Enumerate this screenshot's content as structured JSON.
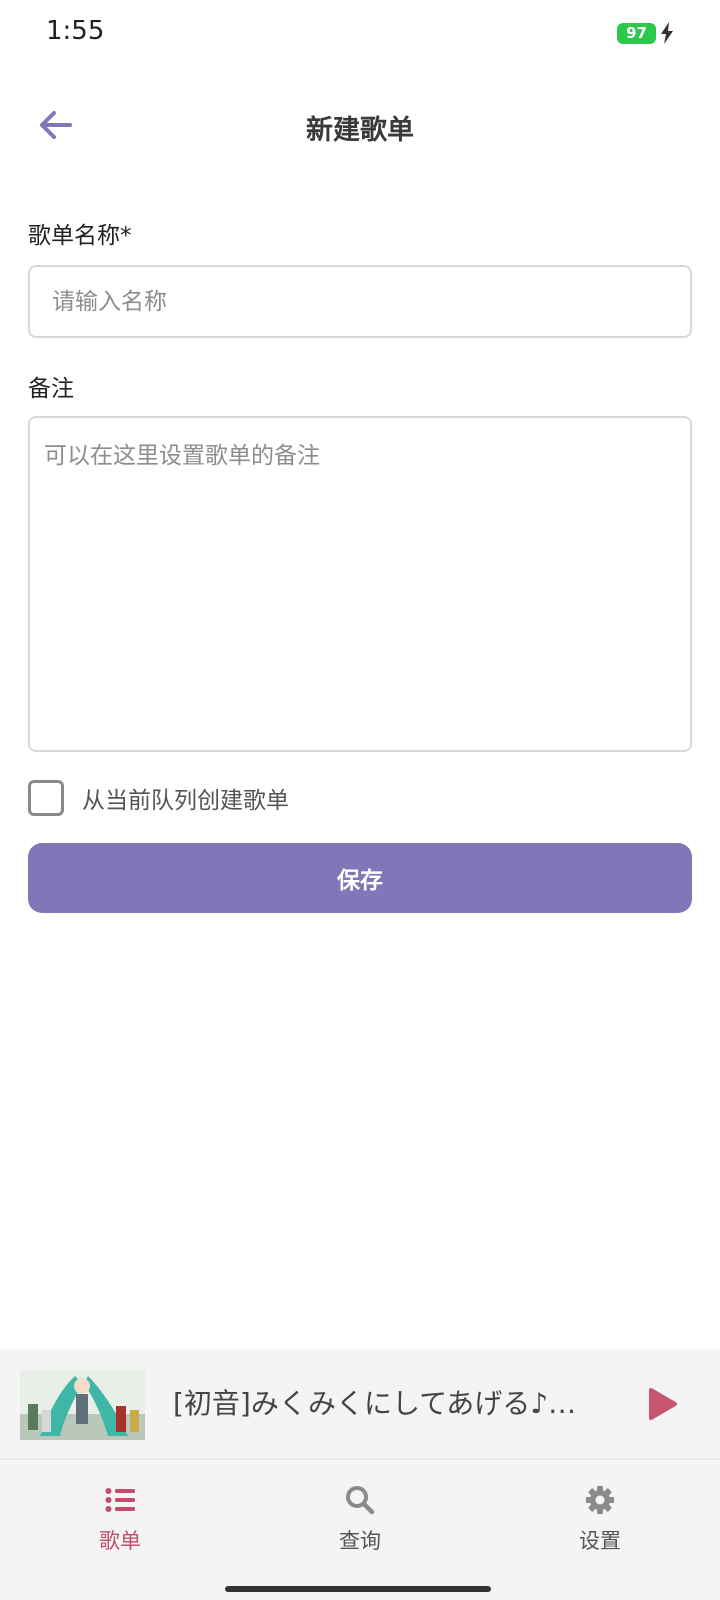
{
  "status_bar": {
    "time": "1:55",
    "battery": "97"
  },
  "header": {
    "title": "新建歌单"
  },
  "form": {
    "name_label": "歌单名称*",
    "name_placeholder": "请输入名称",
    "name_value": "",
    "note_label": "备注",
    "note_placeholder": "可以在这里设置歌单的备注",
    "note_value": "",
    "queue_checkbox_label": "从当前队列创建歌单",
    "queue_checkbox_checked": false,
    "save_label": "保存"
  },
  "mini_player": {
    "song_title": "[初音]みくみくにしてあげる♪【してやんよ】"
  },
  "nav": {
    "items": [
      {
        "label": "歌单",
        "icon": "list-icon",
        "active": true
      },
      {
        "label": "查询",
        "icon": "search-icon",
        "active": false
      },
      {
        "label": "设置",
        "icon": "gear-icon",
        "active": false
      }
    ]
  },
  "colors": {
    "accent": "#7f77b8",
    "active_nav": "#c24e6b",
    "battery": "#2cc84a"
  }
}
